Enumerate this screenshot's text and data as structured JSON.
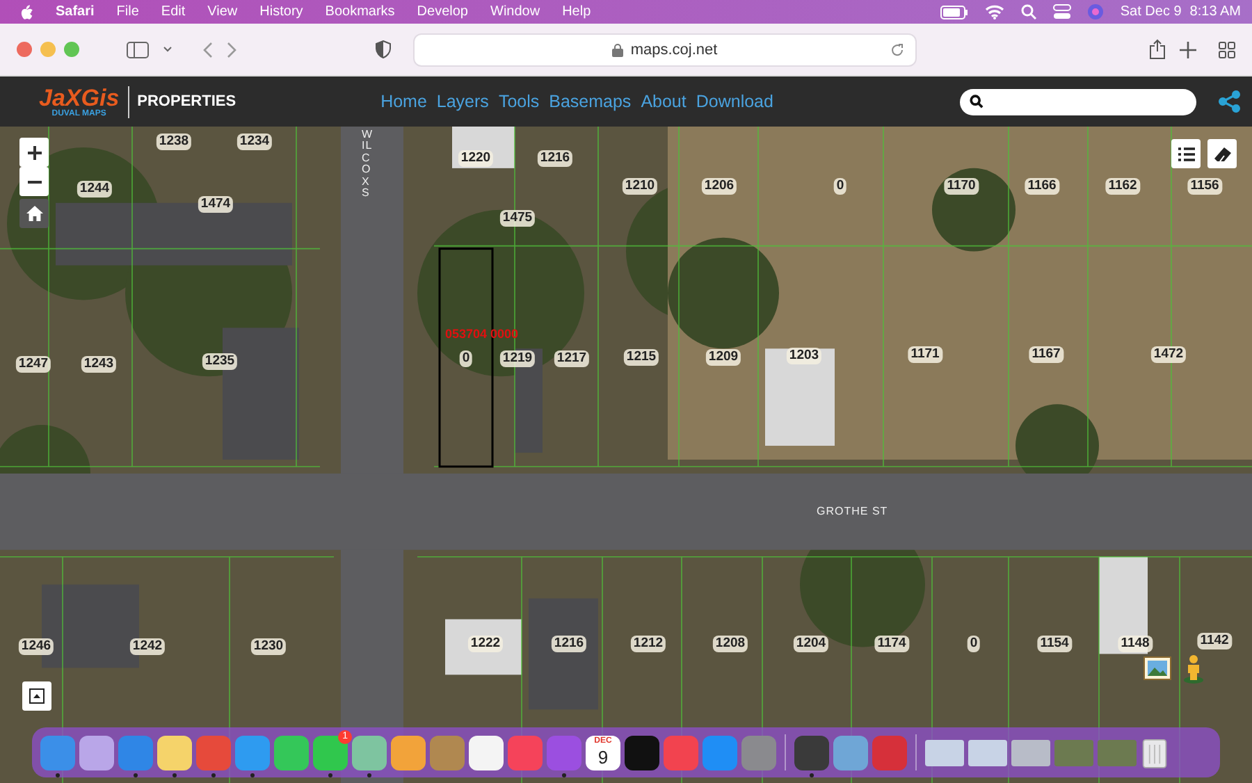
{
  "menu_bar": {
    "app": "Safari",
    "menus": [
      "File",
      "Edit",
      "View",
      "History",
      "Bookmarks",
      "Develop",
      "Window",
      "Help"
    ],
    "date": "Sat Dec 9",
    "time": "8:13 AM"
  },
  "browser": {
    "url": "maps.coj.net"
  },
  "site_header": {
    "logo": "JaXGis",
    "logo_tagline": "DUVAL MAPS",
    "section": "PROPERTIES",
    "nav": [
      "Home",
      "Layers",
      "Tools",
      "Basemaps",
      "About",
      "Download"
    ]
  },
  "map": {
    "streets": [
      {
        "name": "WILCOX S",
        "kind": "vertical"
      },
      {
        "name": "GROTHE ST",
        "kind": "horizontal"
      }
    ],
    "parcel_id": "053704 0000",
    "parcels": [
      "1238",
      "1234",
      "1220",
      "1216",
      "1244",
      "1474",
      "1475",
      "1210",
      "1206",
      "0",
      "1170",
      "1166",
      "1162",
      "1156",
      "1247",
      "1243",
      "1235",
      "0",
      "1219",
      "1217",
      "1215",
      "1209",
      "1203",
      "1171",
      "1167",
      "1472",
      "1246",
      "1242",
      "1230",
      "1222",
      "1216",
      "1212",
      "1208",
      "1204",
      "1174",
      "0",
      "1154",
      "1148",
      "1142"
    ]
  },
  "dock": {
    "items": [
      {
        "kind": "app",
        "color": "#3b8fe8",
        "running": true
      },
      {
        "kind": "app",
        "color": "#b9a6e8",
        "running": false
      },
      {
        "kind": "app",
        "color": "#2f86e6",
        "running": true
      },
      {
        "kind": "app",
        "color": "#f5d36a",
        "running": true
      },
      {
        "kind": "app",
        "color": "#e64a3b",
        "running": true
      },
      {
        "kind": "app",
        "color": "#2e9bf0",
        "running": true
      },
      {
        "kind": "app",
        "color": "#34c759",
        "running": false
      },
      {
        "kind": "app",
        "color": "#30c74d",
        "running": true,
        "badge": "1"
      },
      {
        "kind": "app",
        "color": "#7ec4a0",
        "running": true
      },
      {
        "kind": "app",
        "color": "#f2a33a",
        "running": false
      },
      {
        "kind": "app",
        "color": "#b08850",
        "running": false
      },
      {
        "kind": "app",
        "color": "#f4f4f4",
        "running": false
      },
      {
        "kind": "app",
        "color": "#f5435a",
        "running": false
      },
      {
        "kind": "app",
        "color": "#9b4fe0",
        "running": true
      },
      {
        "kind": "calendar",
        "month": "DEC",
        "day": "9",
        "running": false
      },
      {
        "kind": "app",
        "color": "#111111",
        "running": false
      },
      {
        "kind": "app",
        "color": "#f2434f",
        "running": false
      },
      {
        "kind": "app",
        "color": "#1f8ef5",
        "running": false
      },
      {
        "kind": "app",
        "color": "#8a8a8e",
        "running": false
      },
      {
        "kind": "separator"
      },
      {
        "kind": "app",
        "color": "#3a3a3a",
        "running": true
      },
      {
        "kind": "app",
        "color": "#6fa6d6",
        "running": false
      },
      {
        "kind": "app",
        "color": "#d6303a",
        "running": false
      },
      {
        "kind": "separator"
      },
      {
        "kind": "window",
        "color": "#c8d3e6",
        "running": false
      },
      {
        "kind": "window",
        "color": "#c8d3e6",
        "running": false
      },
      {
        "kind": "window",
        "color": "#b8bcc8",
        "running": false
      },
      {
        "kind": "window",
        "color": "#6c7a50",
        "running": false
      },
      {
        "kind": "window",
        "color": "#6c7a50",
        "running": false
      },
      {
        "kind": "trash",
        "running": false
      }
    ]
  }
}
